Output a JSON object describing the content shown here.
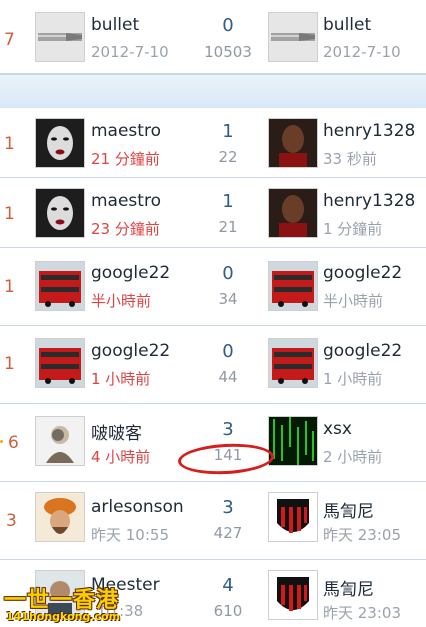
{
  "top_row": {
    "number": "7",
    "author": "bullet",
    "date": "2012-7-10",
    "replies": "0",
    "views": "10503",
    "last_poster": "bullet",
    "last_time": "2012-7-10"
  },
  "threads": [
    {
      "number": "1",
      "author": "maestro",
      "author_time": "21 分鐘前",
      "replies": "1",
      "views": "22",
      "last_poster": "henry1328",
      "last_time": "33 秒前"
    },
    {
      "number": "1",
      "author": "maestro",
      "author_time": "23 分鐘前",
      "replies": "1",
      "views": "21",
      "last_poster": "henry1328",
      "last_time": "1 分鐘前"
    },
    {
      "number": "1",
      "author": "google22",
      "author_time": "半小時前",
      "replies": "0",
      "views": "34",
      "last_poster": "google22",
      "last_time": "半小時前"
    },
    {
      "number": "1",
      "author": "google22",
      "author_time": "1 小時前",
      "replies": "0",
      "views": "44",
      "last_poster": "google22",
      "last_time": "1 小時前"
    },
    {
      "number": "6",
      "author": "啵啵客",
      "author_time": "4 小時前",
      "replies": "3",
      "views": "141",
      "last_poster": "xsx",
      "last_time": "2 小時前"
    },
    {
      "number": "3",
      "author": "arlesonson",
      "author_time": "昨天 10:55",
      "replies": "3",
      "views": "427",
      "last_poster": "馬訇尼",
      "last_time": "昨天 23:05"
    },
    {
      "number": "",
      "author": "Meester",
      "author_time": "01:38",
      "replies": "4",
      "views": "610",
      "last_poster": "馬訇尼",
      "last_time": "昨天 23:03"
    }
  ],
  "watermark": {
    "line1": "一世一香港",
    "line2": "141hongkong.com"
  },
  "colors": {
    "accent_red": "#e04444",
    "number_orange": "#d0603b",
    "replies_blue": "#2e5e88",
    "divider": "#c9d6e3",
    "annotation_circle": "#d81d1d"
  }
}
